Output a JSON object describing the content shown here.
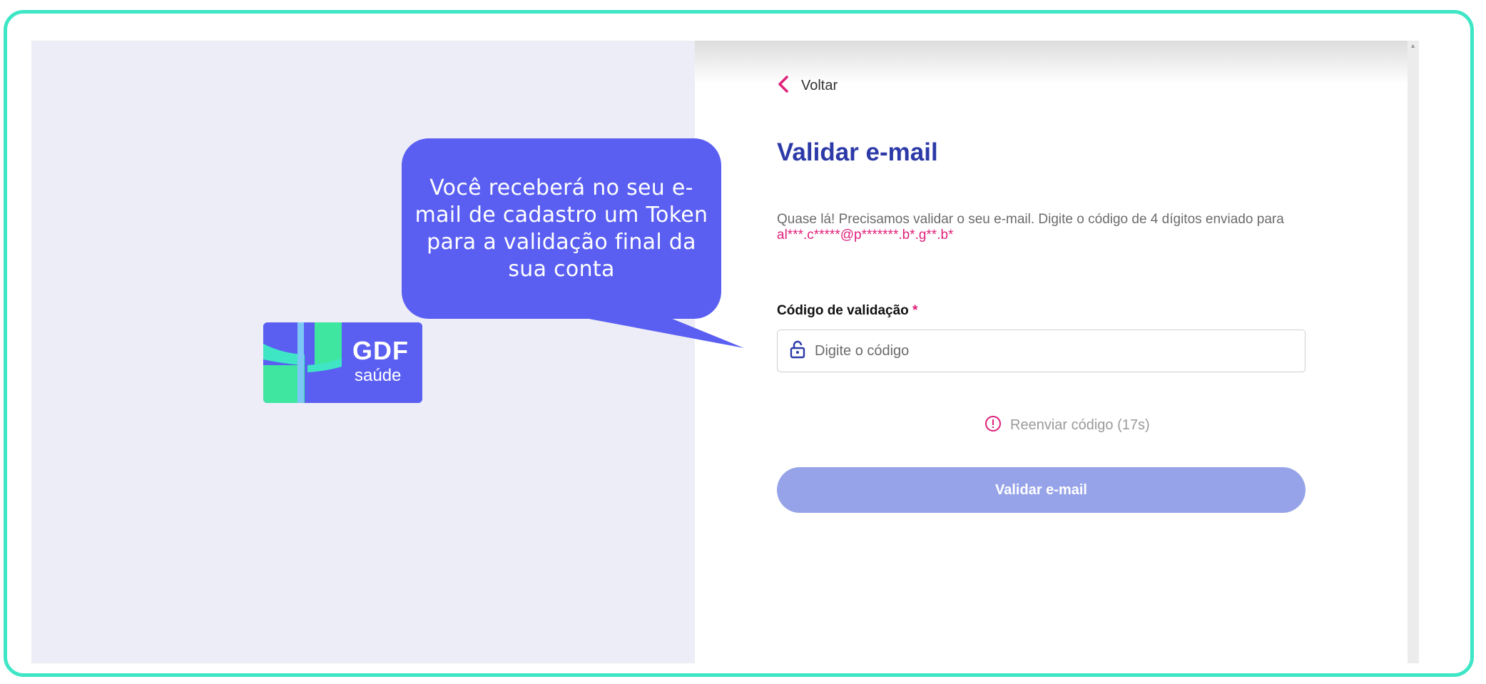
{
  "brand": {
    "logo_text": "GDF",
    "logo_subtext": "saúde",
    "colors": {
      "frame": "#3ee6c5",
      "brand_blue": "#5a5ff2",
      "brand_green": "#3ee6a0",
      "title": "#2c3aa8",
      "accent_pink": "#e0207a",
      "button_disabled": "#96a3e8"
    }
  },
  "nav": {
    "back_label": "Voltar",
    "back_icon": "chevron-left-icon"
  },
  "page": {
    "title": "Validar e-mail",
    "description": "Quase lá! Precisamos validar o seu e-mail. Digite o código de 4 dígitos enviado para",
    "masked_email": "al***.c*****@p*******.b*.g**.b*"
  },
  "form": {
    "code_label": "Código de validação",
    "required_marker": "*",
    "code_placeholder": "Digite o código",
    "code_value": "",
    "lock_icon": "lock-icon"
  },
  "resend": {
    "label": "Reenviar código (17s)",
    "icon": "info-icon"
  },
  "submit": {
    "label": "Validar e-mail",
    "disabled": true
  },
  "callout": {
    "text": "Você receberá no seu e-mail de cadastro um Token para a validação final da sua conta"
  }
}
